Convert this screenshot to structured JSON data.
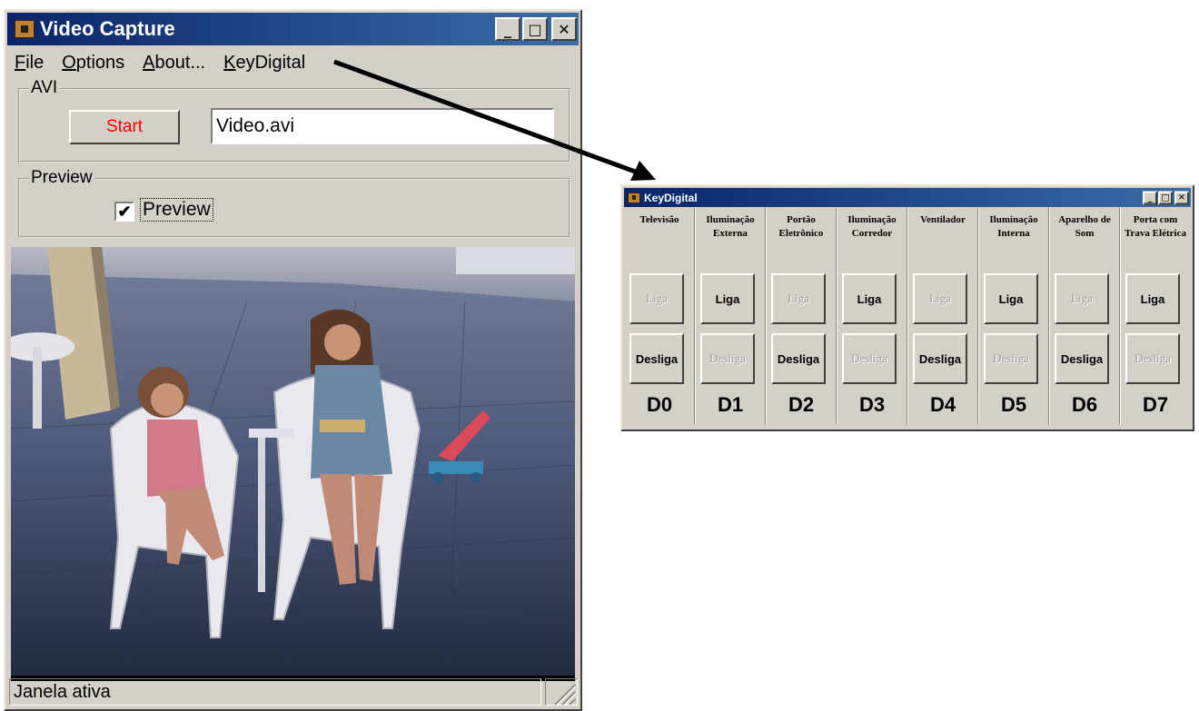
{
  "video_capture": {
    "title": "Video Capture",
    "window_controls": {
      "minimize": "_",
      "maximize": "□",
      "close": "✕"
    },
    "menu": [
      {
        "label_underlined": "F",
        "label_rest": "ile"
      },
      {
        "label_underlined": "O",
        "label_rest": "ptions"
      },
      {
        "label_underlined": "A",
        "label_rest": "bout..."
      },
      {
        "label_underlined": "K",
        "label_rest": "eyDigital"
      }
    ],
    "avi_group": {
      "legend": "AVI",
      "start_label": "Start",
      "start_color": "#ff0000",
      "filename_value": "Video.avi"
    },
    "preview_group": {
      "legend": "Preview",
      "checkbox_checked": true,
      "checkbox_glyph": "✔",
      "checkbox_label": "Preview"
    },
    "status_text": "Janela ativa"
  },
  "key_digital": {
    "title": "KeyDigital",
    "window_controls": {
      "minimize": "_",
      "maximize": "□",
      "close": "✕"
    },
    "channels": [
      {
        "label": "Televisão",
        "liga": "Liga",
        "desliga": "Desliga",
        "liga_enabled": false,
        "desliga_enabled": true,
        "output": "D0"
      },
      {
        "label": "Iluminação Externa",
        "liga": "Liga",
        "desliga": "Desliga",
        "liga_enabled": true,
        "desliga_enabled": false,
        "output": "D1"
      },
      {
        "label": "Portão Eletrônico",
        "liga": "Liga",
        "desliga": "Desliga",
        "liga_enabled": false,
        "desliga_enabled": true,
        "output": "D2"
      },
      {
        "label": "Iluminação Corredor",
        "liga": "Liga",
        "desliga": "Desliga",
        "liga_enabled": true,
        "desliga_enabled": false,
        "output": "D3"
      },
      {
        "label": "Ventilador",
        "liga": "Liga",
        "desliga": "Desliga",
        "liga_enabled": false,
        "desliga_enabled": true,
        "output": "D4"
      },
      {
        "label": "Iluminação Interna",
        "liga": "Liga",
        "desliga": "Desliga",
        "liga_enabled": true,
        "desliga_enabled": false,
        "output": "D5"
      },
      {
        "label": "Aparelho de Som",
        "liga": "Liga",
        "desliga": "Desliga",
        "liga_enabled": false,
        "desliga_enabled": true,
        "output": "D6"
      },
      {
        "label": "Porta com Trava Elétrica",
        "liga": "Liga",
        "desliga": "Desliga",
        "liga_enabled": true,
        "desliga_enabled": false,
        "output": "D7"
      }
    ]
  }
}
